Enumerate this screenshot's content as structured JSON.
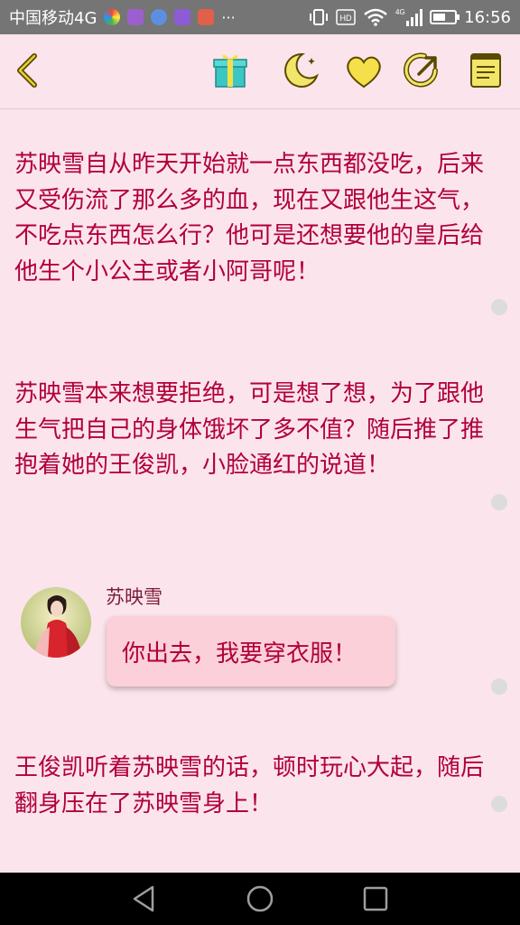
{
  "status_bar": {
    "carrier": "中国移动4G",
    "more": "···",
    "time": "16:56",
    "battery_level": 0.6,
    "icons": [
      "app-icon-1",
      "app-icon-2",
      "app-icon-3",
      "app-icon-4",
      "app-icon-5",
      "vibrate-icon",
      "hd-icon",
      "wifi-icon",
      "4g-signal-icon",
      "battery-icon"
    ]
  },
  "toolbar": {
    "icons": [
      "back-icon",
      "gift-icon",
      "night-mode-icon",
      "favorite-icon",
      "share-icon",
      "notes-icon"
    ],
    "colors": {
      "icon": "#e8d03a",
      "outline": "#5a4a00",
      "gift": "#3bc6c4"
    }
  },
  "content": {
    "paragraphs": [
      "苏映雪自从昨天开始就一点东西都没吃，后来又受伤流了那么多的血，现在又跟他生这气，不吃点东西怎么行？他可是还想要他的皇后给他生个小公主或者小阿哥呢！",
      "苏映雪本来想要拒绝，可是想了想，为了跟他生气把自己的身体饿坏了多不值？随后推了推抱着她的王俊凯，小脸通红的说道！",
      "王俊凯听着苏映雪的话，顿时玩心大起，随后翻身压在了苏映雪身上！"
    ],
    "dialogue": {
      "speaker": "苏映雪",
      "text": "你出去，我要穿衣服！"
    },
    "colors": {
      "text": "#b0003a",
      "background": "#fce4ec",
      "bubble": "#fbd0d9"
    }
  },
  "nav_bar": {
    "buttons": [
      "back-triangle-icon",
      "home-circle-icon",
      "recents-square-icon"
    ]
  }
}
